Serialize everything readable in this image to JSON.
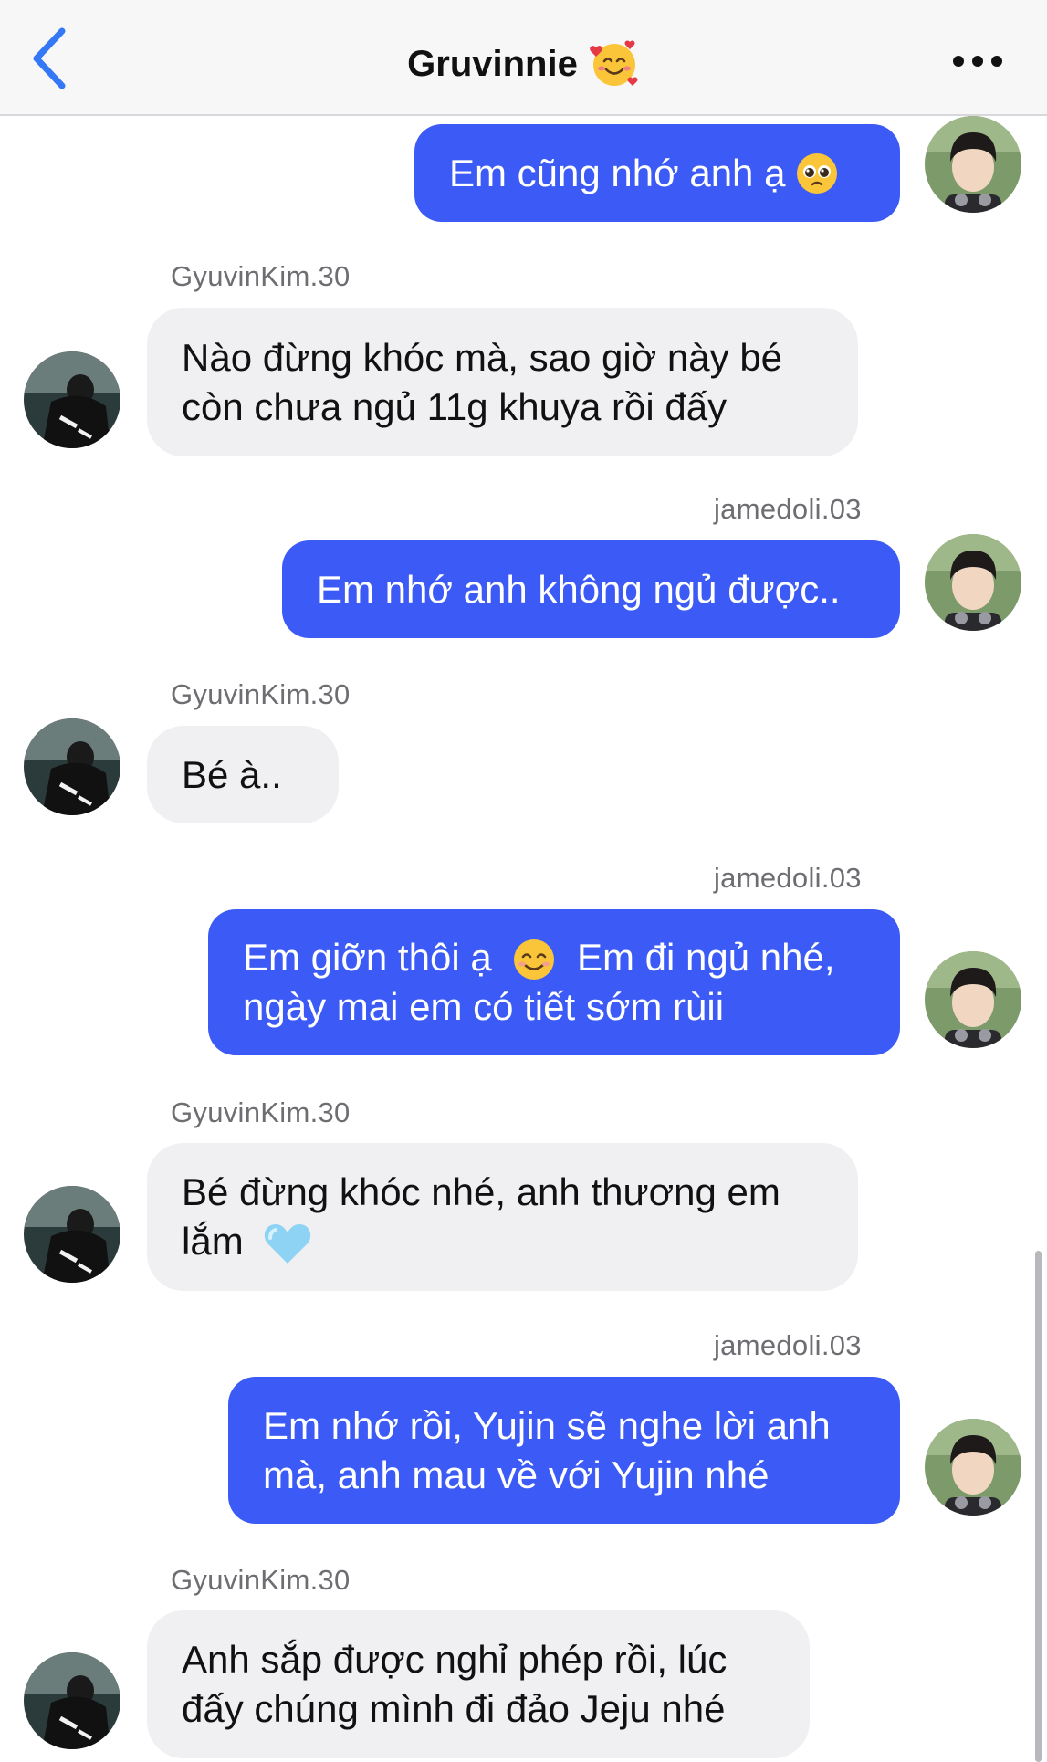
{
  "header": {
    "title": "Gruvinnie",
    "title_emoji": "smiling-face-with-hearts-emoji"
  },
  "colors": {
    "outgoing_bubble": "#3c5af5",
    "incoming_bubble": "#f0f0f3",
    "back_arrow": "#3478f6"
  },
  "messages": [
    {
      "dir": "out",
      "sender": "",
      "lines": [
        "Em cũng nhớ anh ạ"
      ],
      "emoji": "pleading-face-emoji"
    },
    {
      "dir": "in",
      "sender": "GyuvinKim.30",
      "lines": [
        "Nào đừng khóc mà, sao giờ này bé",
        "còn chưa ngủ 11g khuya rồi đấy"
      ]
    },
    {
      "dir": "out",
      "sender": "jamedoli.03",
      "lines": [
        "Em nhớ anh không ngủ được.."
      ]
    },
    {
      "dir": "in",
      "sender": "GyuvinKim.30",
      "lines": [
        "Bé à.."
      ]
    },
    {
      "dir": "out",
      "sender": "jamedoli.03",
      "lines": [
        "Em giỡn thôi ạ",
        "Em đi ngủ nhé,",
        "ngày mai em có tiết sớm rùii"
      ],
      "emoji": "smiling-face-emoji"
    },
    {
      "dir": "in",
      "sender": "GyuvinKim.30",
      "lines": [
        "Bé đừng khóc nhé, anh thương em",
        "lắm"
      ],
      "emoji": "light-blue-heart-emoji"
    },
    {
      "dir": "out",
      "sender": "jamedoli.03",
      "lines": [
        "Em nhớ rồi, Yujin sẽ nghe lời anh",
        "mà, anh mau về với Yujin nhé"
      ]
    },
    {
      "dir": "in",
      "sender": "GyuvinKim.30",
      "lines": [
        "Anh sắp được nghỉ phép rồi, lúc",
        "đấy chúng mình đi đảo Jeju nhé"
      ]
    }
  ]
}
